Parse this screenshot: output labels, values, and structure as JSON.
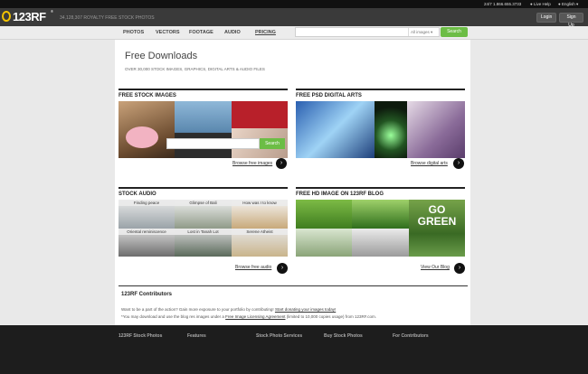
{
  "topbar": {
    "phone": "24/7  1.866.655.3733",
    "live_help": "Live Help",
    "language": "English"
  },
  "header": {
    "logo": "123RF",
    "logo_tm": "®",
    "tagline": "34,128,307  ROYALTY FREE STOCK PHOTOS",
    "login_label": "Login",
    "signup_label": "Sign Up"
  },
  "nav": {
    "items": [
      "PHOTOS",
      "VECTORS",
      "FOOTAGE",
      "AUDIO",
      "PRICING"
    ],
    "active_index": 4,
    "search": {
      "value": "",
      "scope": "All images",
      "button": "Search"
    }
  },
  "page": {
    "title": "Free Downloads",
    "subtitle": "OVER 30,000 STOCK IMAGES, GRAPHICS, DIGITAL ARTS & AUDIO FILES"
  },
  "sections": [
    {
      "heading": "FREE STOCK IMAGES",
      "link": "Browse free images",
      "search_button": "Search"
    },
    {
      "heading": "FREE PSD DIGITAL ARTS",
      "link": "Browse digital arts"
    },
    {
      "heading": "STOCK AUDIO",
      "link": "Browse free audio",
      "tiles": [
        "Finding peace",
        "Glimpse of Bali",
        "How was I to know",
        "Oriental reminiscence",
        "Lost in Tanah Lot",
        "Serene Atheist"
      ]
    },
    {
      "heading": "FREE HD IMAGE ON 123RF BLOG",
      "link": "View Our Blog",
      "overlay_line1": "GO",
      "overlay_line2": "GREEN"
    }
  ],
  "contributors": {
    "title": "123RF Contributors",
    "line1_text": "Want to be a part of the action? Gain more exposure to your portfolio by contributing! ",
    "line1_link": "Start donating your images today!",
    "line2_text": "*You may download and use the blog res images under a ",
    "line2_link": "Free Image Licensing Agreement",
    "line2_tail": " (limited to 10,000 copies usage) from 123RF.com."
  },
  "footer": {
    "columns": [
      "123RF Stock Photos",
      "Features",
      "Stock Photo Services",
      "Buy Stock Photos",
      "For Contributors"
    ]
  },
  "colors": {
    "accent_green": "#6cbd45",
    "logo_yellow": "#f4c400",
    "header_bg": "#3a3a3a"
  },
  "icons": [
    "phone-icon",
    "live-help-icon",
    "globe-icon",
    "arrow-right-icon",
    "dropdown-icon"
  ]
}
